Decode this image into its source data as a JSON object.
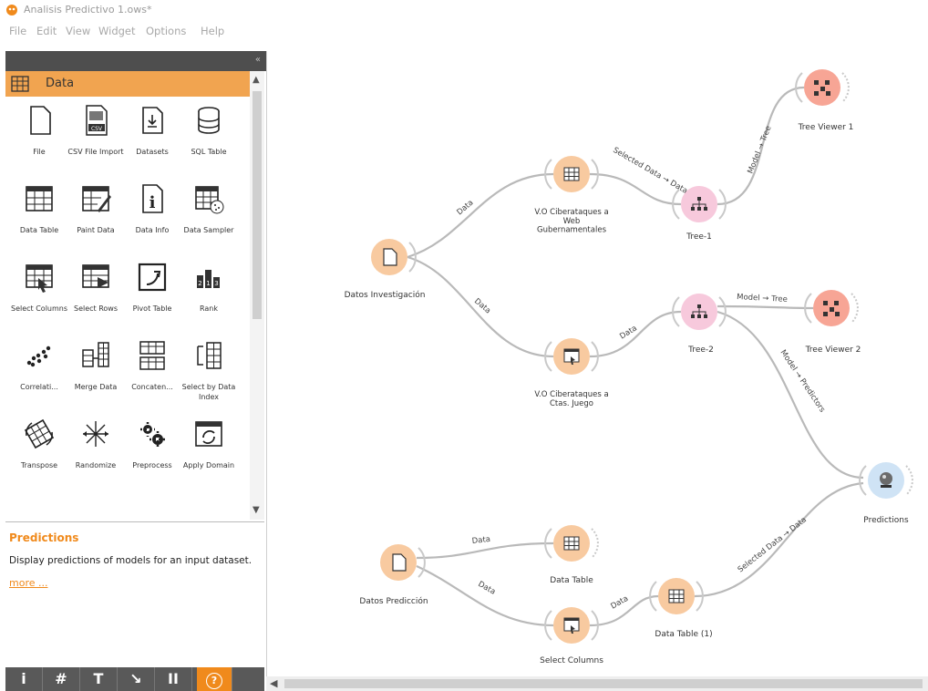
{
  "window": {
    "title": "Analisis Predictivo 1.ows*"
  },
  "menu": [
    "File",
    "Edit",
    "View",
    "Widget",
    "Options",
    "Help"
  ],
  "sidebar": {
    "category": "Data",
    "widgets": [
      {
        "label": "File",
        "icon": "file-icon"
      },
      {
        "label": "CSV File Import",
        "icon": "csv-icon"
      },
      {
        "label": "Datasets",
        "icon": "datasets-icon"
      },
      {
        "label": "SQL Table",
        "icon": "database-icon"
      },
      {
        "label": "Data Table",
        "icon": "table-icon"
      },
      {
        "label": "Paint Data",
        "icon": "paint-icon"
      },
      {
        "label": "Data Info",
        "icon": "info-icon"
      },
      {
        "label": "Data Sampler",
        "icon": "sampler-icon"
      },
      {
        "label": "Select Columns",
        "icon": "select-columns-icon"
      },
      {
        "label": "Select Rows",
        "icon": "select-rows-icon"
      },
      {
        "label": "Pivot Table",
        "icon": "pivot-icon"
      },
      {
        "label": "Rank",
        "icon": "rank-icon"
      },
      {
        "label": "Correlati...",
        "icon": "correlations-icon"
      },
      {
        "label": "Merge Data",
        "icon": "merge-icon"
      },
      {
        "label": "Concaten...",
        "icon": "concatenate-icon"
      },
      {
        "label": "Select by Data Index",
        "icon": "select-index-icon"
      },
      {
        "label": "Transpose",
        "icon": "transpose-icon"
      },
      {
        "label": "Randomize",
        "icon": "randomize-icon"
      },
      {
        "label": "Preprocess",
        "icon": "preprocess-icon"
      },
      {
        "label": "Apply Domain",
        "icon": "apply-domain-icon"
      }
    ],
    "help": {
      "title": "Predictions",
      "description": "Display predictions of models for an input dataset.",
      "more": "more ..."
    },
    "toolbar": [
      "i",
      "#",
      "T",
      "↘",
      "II",
      "?"
    ]
  },
  "canvas": {
    "nodes": [
      {
        "id": "datos_inv",
        "label": "Datos Investigación",
        "kind": "file"
      },
      {
        "id": "vo_web",
        "label": "V.O Ciberataques a Web Gubernamentales",
        "kind": "table"
      },
      {
        "id": "tree1",
        "label": "Tree-1",
        "kind": "tree"
      },
      {
        "id": "treeviewer1",
        "label": "Tree Viewer 1",
        "kind": "treeviewer"
      },
      {
        "id": "vo_juego",
        "label": "V.O Ciberataques a Ctas. Juego",
        "kind": "select"
      },
      {
        "id": "tree2",
        "label": "Tree-2",
        "kind": "tree"
      },
      {
        "id": "treeviewer2",
        "label": "Tree Viewer 2",
        "kind": "treeviewer"
      },
      {
        "id": "predictions",
        "label": "Predictions",
        "kind": "predictions"
      },
      {
        "id": "datos_pred",
        "label": "Datos Predicción",
        "kind": "file"
      },
      {
        "id": "datatable",
        "label": "Data Table",
        "kind": "table"
      },
      {
        "id": "selectcols",
        "label": "Select Columns",
        "kind": "select"
      },
      {
        "id": "datatable1",
        "label": "Data Table (1)",
        "kind": "table"
      }
    ],
    "links": [
      "Data",
      "Data",
      "Selected Data → Data",
      "Model → Tree",
      "Data",
      "Model → Tree",
      "Model → Predictors",
      "Data",
      "Data",
      "Data",
      "Selected Data → Data"
    ]
  },
  "colors": {
    "orange": "#f1a450",
    "pink": "#f4a6c4",
    "blue": "#a7cdeb",
    "accent": "#f08a1c"
  }
}
